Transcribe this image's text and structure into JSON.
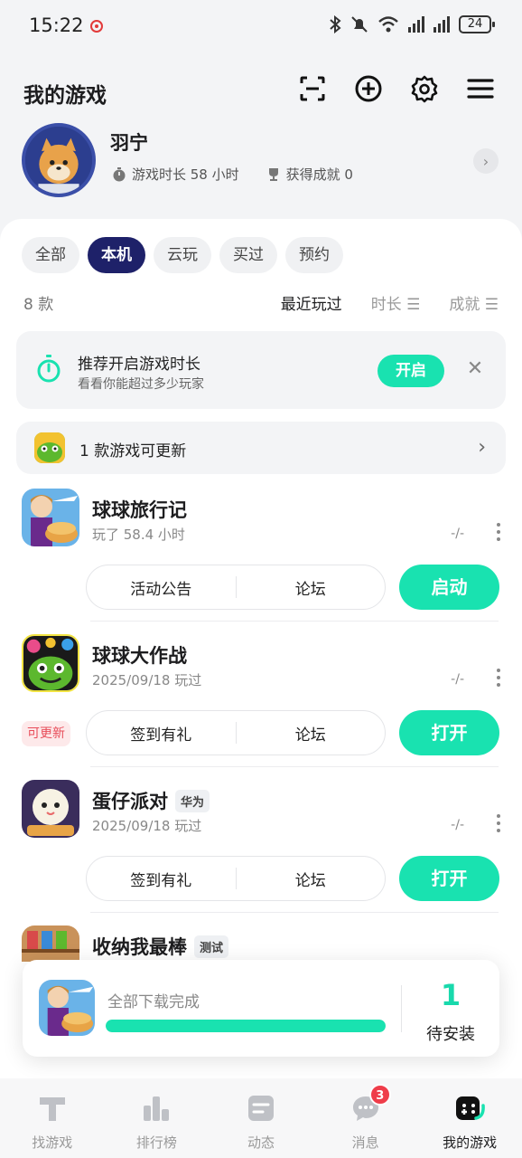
{
  "status_bar": {
    "time": "15:22",
    "battery": "24"
  },
  "header": {
    "title": "我的游戏"
  },
  "profile": {
    "name": "羽宁",
    "playtime": "游戏时长 58 小时",
    "achievements": "获得成就 0"
  },
  "tabs": [
    {
      "label": "全部"
    },
    {
      "label": "本机"
    },
    {
      "label": "云玩"
    },
    {
      "label": "买过"
    },
    {
      "label": "预约"
    }
  ],
  "list_header": {
    "count": "8 款",
    "sort_recent": "最近玩过",
    "sort_time": "时长 ☰",
    "sort_achievement": "成就 ☰"
  },
  "banner": {
    "title": "推荐开启游戏时长",
    "subtitle": "看看你能超过多少玩家",
    "button": "开启"
  },
  "update_bar": {
    "text": "1 款游戏可更新"
  },
  "games": [
    {
      "name": "球球旅行记",
      "tag": "",
      "sub": "玩了 58.4 小时",
      "dash": "-/-",
      "opt1": "活动公告",
      "opt2": "论坛",
      "action": "启动",
      "update_badge": ""
    },
    {
      "name": "球球大作战",
      "tag": "",
      "sub": "2025/09/18 玩过",
      "dash": "-/-",
      "opt1": "签到有礼",
      "opt2": "论坛",
      "action": "打开",
      "update_badge": "可更新"
    },
    {
      "name": "蛋仔派对",
      "tag": "华为",
      "sub": "2025/09/18 玩过",
      "dash": "-/-",
      "opt1": "签到有礼",
      "opt2": "论坛",
      "action": "打开",
      "update_badge": ""
    },
    {
      "name": "收纳我最棒",
      "tag": "测试",
      "sub": "",
      "dash": "",
      "opt1": "",
      "opt2": "",
      "action": "",
      "update_badge": ""
    }
  ],
  "download": {
    "text": "全部下载完成",
    "progress": 1.0,
    "pending_count": "1",
    "pending_label": "待安装"
  },
  "nav": [
    {
      "label": "找游戏",
      "icon": "find-game-icon"
    },
    {
      "label": "排行榜",
      "icon": "ranking-icon"
    },
    {
      "label": "动态",
      "icon": "feed-icon"
    },
    {
      "label": "消息",
      "icon": "message-icon",
      "badge": "3"
    },
    {
      "label": "我的游戏",
      "icon": "my-games-icon"
    }
  ],
  "colors": {
    "accent": "#19e2b0",
    "tab_active": "#1e2169",
    "badge": "#ef3d4a"
  }
}
